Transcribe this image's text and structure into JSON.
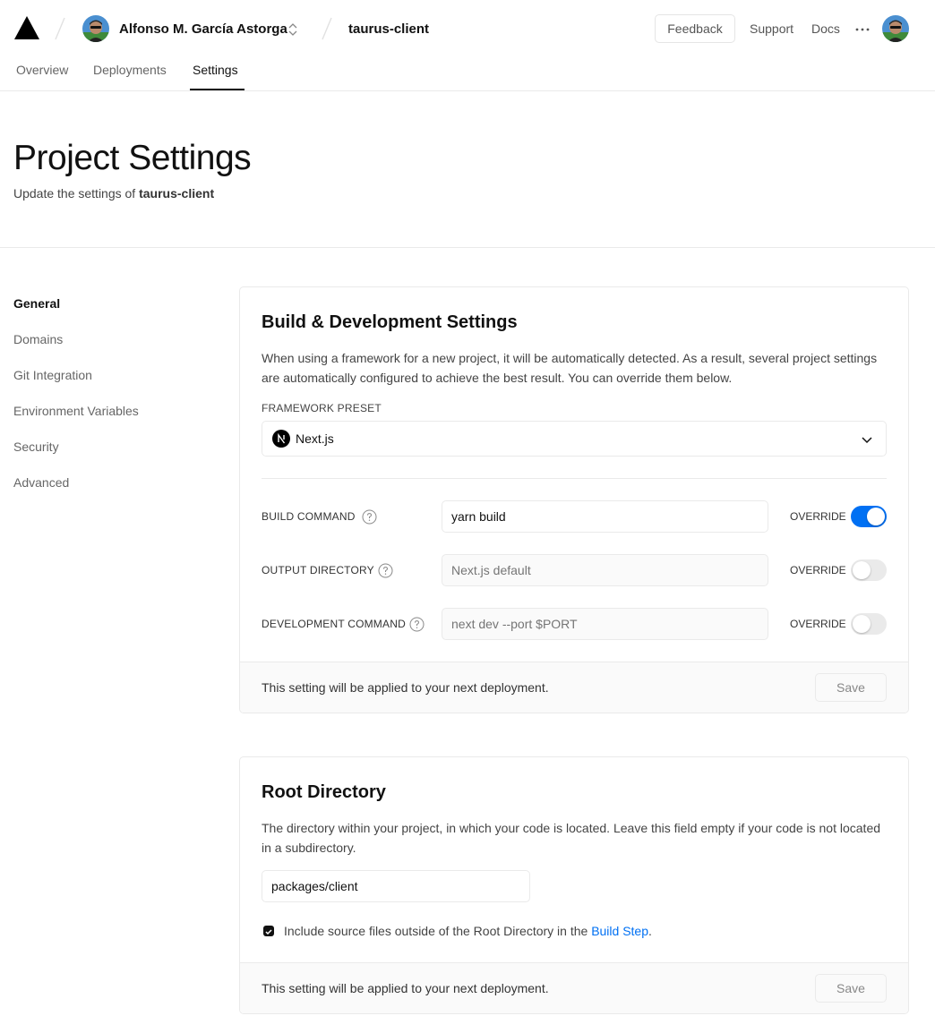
{
  "header": {
    "team_name": "Alfonso M. García Astorga",
    "project_name": "taurus-client",
    "feedback_label": "Feedback",
    "support_label": "Support",
    "docs_label": "Docs",
    "logo_icon": "vercel-triangle-icon",
    "more_icon": "ellipsis-icon"
  },
  "tabs": [
    {
      "label": "Overview",
      "active": false
    },
    {
      "label": "Deployments",
      "active": false
    },
    {
      "label": "Settings",
      "active": true
    }
  ],
  "page": {
    "title": "Project Settings",
    "subtitle_prefix": "Update the settings of ",
    "subtitle_project": "taurus-client"
  },
  "sidebar": {
    "items": [
      {
        "label": "General",
        "active": true
      },
      {
        "label": "Domains",
        "active": false
      },
      {
        "label": "Git Integration",
        "active": false
      },
      {
        "label": "Environment Variables",
        "active": false
      },
      {
        "label": "Security",
        "active": false
      },
      {
        "label": "Advanced",
        "active": false
      }
    ]
  },
  "build_settings": {
    "title": "Build & Development Settings",
    "description": "When using a framework for a new project, it will be automatically detected. As a result, several project settings are automatically configured to achieve the best result. You can override them below.",
    "framework_label": "FRAMEWORK PRESET",
    "framework_value": "Next.js",
    "rows": [
      {
        "label": "BUILD COMMAND",
        "value": "yarn build",
        "placeholder": "",
        "override_label": "OVERRIDE",
        "override": true
      },
      {
        "label": "OUTPUT DIRECTORY",
        "value": "",
        "placeholder": "Next.js default",
        "override_label": "OVERRIDE",
        "override": false
      },
      {
        "label": "DEVELOPMENT COMMAND",
        "value": "",
        "placeholder": "next dev --port $PORT",
        "override_label": "OVERRIDE",
        "override": false
      }
    ],
    "footer_text": "This setting will be applied to your next deployment.",
    "save_label": "Save"
  },
  "root_directory": {
    "title": "Root Directory",
    "description": "The directory within your project, in which your code is located. Leave this field empty if your code is not located in a subdirectory.",
    "value": "packages/client",
    "checkbox_checked": true,
    "checkbox_text": "Include source files outside of the Root Directory in the ",
    "checkbox_link": "Build Step",
    "checkbox_suffix": ".",
    "footer_text": "This setting will be applied to your next deployment.",
    "save_label": "Save"
  },
  "colors": {
    "accent": "#0070f3",
    "text": "#111111",
    "muted": "#666666",
    "border": "#eaeaea"
  }
}
